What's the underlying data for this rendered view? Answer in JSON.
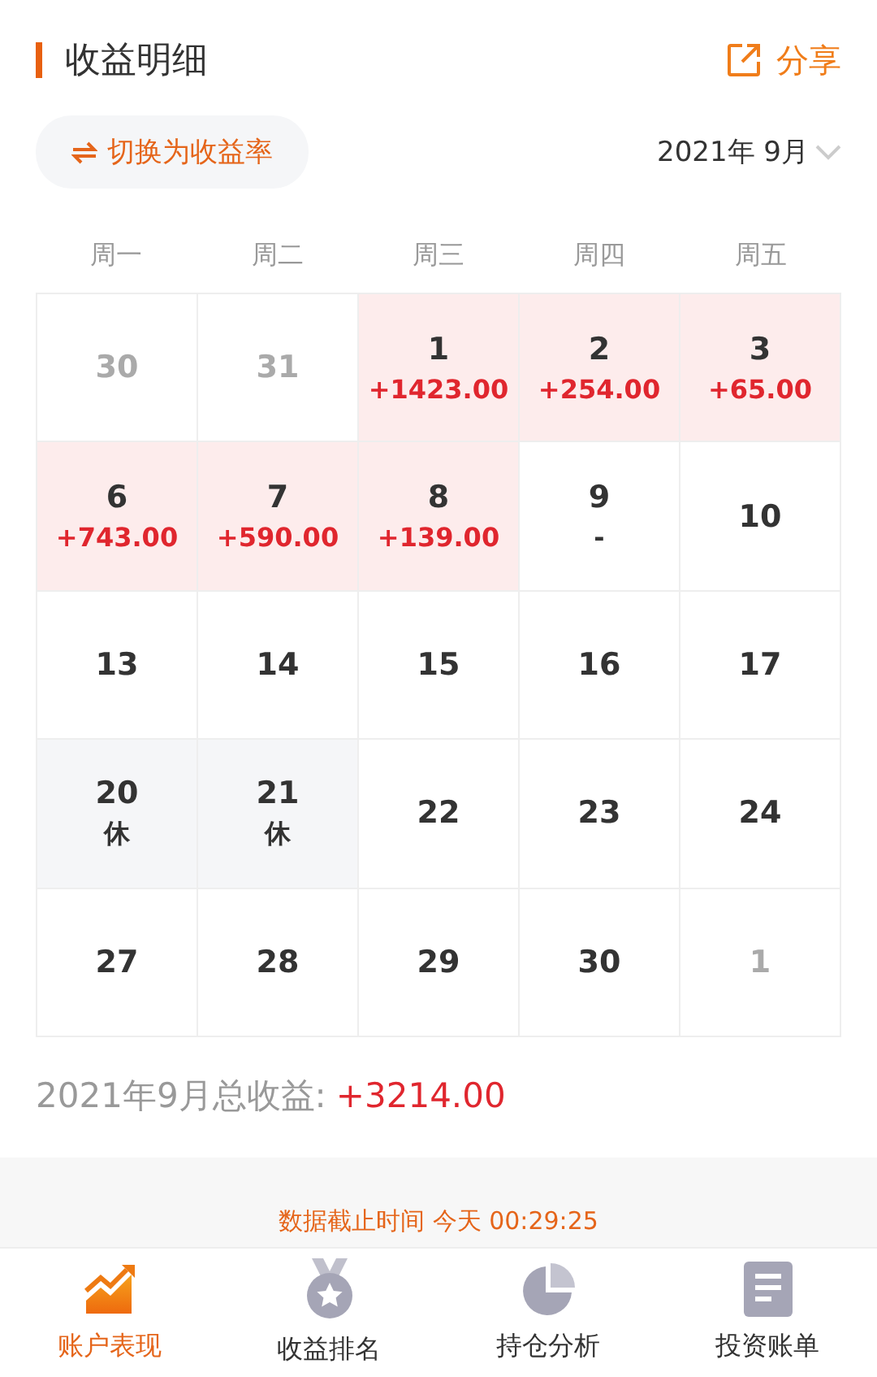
{
  "header": {
    "title": "收益明细",
    "share": "分享"
  },
  "toggle_button": "切换为收益率",
  "month_picker": "2021年 9月",
  "weekdays": [
    "周一",
    "周二",
    "周三",
    "周四",
    "周五"
  ],
  "days": [
    {
      "day": "30",
      "kind": "other"
    },
    {
      "day": "31",
      "kind": "other"
    },
    {
      "day": "1",
      "amount": "+1423.00",
      "kind": "gain"
    },
    {
      "day": "2",
      "amount": "+254.00",
      "kind": "gain"
    },
    {
      "day": "3",
      "amount": "+65.00",
      "kind": "gain"
    },
    {
      "day": "6",
      "amount": "+743.00",
      "kind": "gain"
    },
    {
      "day": "7",
      "amount": "+590.00",
      "kind": "gain"
    },
    {
      "day": "8",
      "amount": "+139.00",
      "kind": "gain"
    },
    {
      "day": "9",
      "amount": "-",
      "kind": "normal"
    },
    {
      "day": "10",
      "kind": "normal"
    },
    {
      "day": "13",
      "kind": "normal"
    },
    {
      "day": "14",
      "kind": "normal"
    },
    {
      "day": "15",
      "kind": "normal"
    },
    {
      "day": "16",
      "kind": "normal"
    },
    {
      "day": "17",
      "kind": "normal"
    },
    {
      "day": "20",
      "amount": "休",
      "kind": "holiday"
    },
    {
      "day": "21",
      "amount": "休",
      "kind": "holiday"
    },
    {
      "day": "22",
      "kind": "normal"
    },
    {
      "day": "23",
      "kind": "normal"
    },
    {
      "day": "24",
      "kind": "normal"
    },
    {
      "day": "27",
      "kind": "normal"
    },
    {
      "day": "28",
      "kind": "normal"
    },
    {
      "day": "29",
      "kind": "normal"
    },
    {
      "day": "30",
      "kind": "normal"
    },
    {
      "day": "1",
      "kind": "other"
    }
  ],
  "total": {
    "label": "2021年9月总收益:",
    "value": "+3214.00"
  },
  "update_note": "数据截止时间 今天 00:29:25",
  "tabs": [
    {
      "label": "账户表现",
      "kind": "chart",
      "selected": true
    },
    {
      "label": "收益排名",
      "kind": "medal",
      "selected": false
    },
    {
      "label": "持仓分析",
      "kind": "pie",
      "selected": false
    },
    {
      "label": "投资账单",
      "kind": "bill",
      "selected": false
    }
  ]
}
